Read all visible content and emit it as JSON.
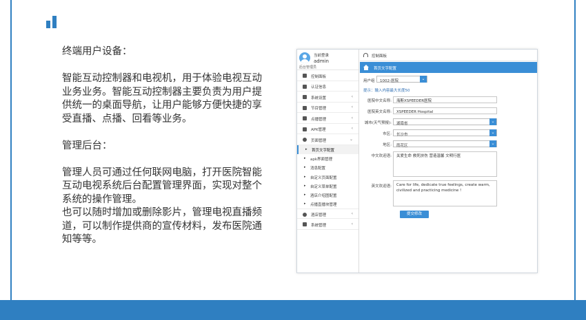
{
  "description": {
    "heading1": "终端用户设备：",
    "para1": "智能互动控制器和电视机，用于体验电视互动业务业务。智能互动控制器主要负责为用户提供统一的桌面导航，让用户能够方便快捷的享受直播、点播、回看等业务。",
    "heading2": "管理后台：",
    "para2": "管理人员可通过任何联网电脑，打开医院智能互动电视系统后台配置管理界面，实现对整个系统的操作管理。",
    "para3": "也可以随时增加或删除影片，管理电视直播频道，可以制作提供商的宣传材料，发布医院通知等等。"
  },
  "admin": {
    "user": {
      "status": "当前登录",
      "name": "admin",
      "role": "后台管理员"
    },
    "menu": [
      {
        "label": "控制面板",
        "icon": "dashboard-icon",
        "has_arrow": false
      },
      {
        "label": "认证信息",
        "icon": "leaf-icon",
        "has_arrow": false
      },
      {
        "label": "系统设置",
        "icon": "gear-icon",
        "has_arrow": true
      },
      {
        "label": "节目管理",
        "icon": "film-icon",
        "has_arrow": true
      },
      {
        "label": "点播管理",
        "icon": "monitor-icon",
        "has_arrow": true
      },
      {
        "label": "APK管理",
        "icon": "android-icon",
        "has_arrow": true
      },
      {
        "label": "页面管理",
        "icon": "plus-circle-icon",
        "has_arrow": true,
        "expanded": true
      }
    ],
    "submenu": [
      {
        "label": "首页文字配置",
        "active": true
      },
      {
        "label": "apk界面管理"
      },
      {
        "label": "消息配置"
      },
      {
        "label": "自定义页面配置"
      },
      {
        "label": "自定义菜单配置"
      },
      {
        "label": "酒店介绍图配置"
      },
      {
        "label": "点播直播块管理"
      }
    ],
    "menu_after": [
      {
        "label": "酒店管理",
        "icon": "refresh-icon",
        "has_arrow": true
      },
      {
        "label": "系统管理",
        "icon": "gears-icon",
        "has_arrow": true
      }
    ],
    "breadcrumb": "控制面板",
    "page_title": "首页文字配置",
    "user_select": {
      "label": "用户组",
      "value": "1002-医院"
    },
    "hint": "提示：输入内容最大长度50",
    "form": {
      "hospital_cn": {
        "label": "医院中文名称:",
        "value": "海斯XSPEEDER医院"
      },
      "hospital_en": {
        "label": "医院英文名称:",
        "value": "XSPEEDER Hospital"
      },
      "city_weather": {
        "label": "城市(天气预报):",
        "value": "湖南省"
      },
      "city": {
        "label": "市区:",
        "value": "长沙市"
      },
      "district": {
        "label": "地区:",
        "value": "雨花区"
      },
      "slogan_cn": {
        "label": "中文欢迎语:",
        "value": "关爱生命 救死扶伤 营造温馨 文明行医"
      },
      "slogan_en": {
        "label": "英文欢迎语:",
        "value": "Care for life, dedicate true feelings, create warm, civilized and practicing medicine !"
      }
    },
    "submit_label": "提交修改"
  },
  "colors": {
    "accent": "#2f7fc1",
    "header_bar": "#3a8ed6"
  }
}
